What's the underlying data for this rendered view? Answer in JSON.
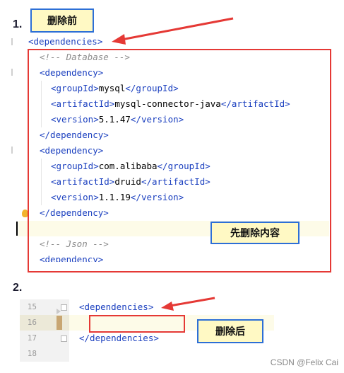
{
  "step1": {
    "number": "1.",
    "label": "删除前"
  },
  "step2": {
    "number": "2.",
    "label": "删除后"
  },
  "middle_label": "先删除内容",
  "code1": {
    "open_tag": "<dependencies>",
    "comment_db": "<!-- Database -->",
    "dep_open": "<dependency>",
    "dep_close": "</dependency>",
    "dep1": {
      "group_open": "<groupId>",
      "group_val": "mysql",
      "group_close": "</groupId>",
      "artifact_open": "<artifactId>",
      "artifact_val": "mysql-connector-java",
      "artifact_close": "</artifactId>",
      "version_open": "<version>",
      "version_val": "5.1.47",
      "version_close": "</version>"
    },
    "dep2": {
      "group_open": "<groupId>",
      "group_val": "com.alibaba",
      "group_close": "</groupId>",
      "artifact_open": "<artifactId>",
      "artifact_val": "druid",
      "artifact_close": "</artifactId>",
      "version_open": "<version>",
      "version_val": "1.1.19",
      "version_close": "</version>"
    },
    "comment_json": "<!-- Json -->",
    "dep3_partial": "<dependency>"
  },
  "code2": {
    "line_numbers": [
      "15",
      "16",
      "17",
      "18"
    ],
    "open_tag": "<dependencies>",
    "close_tag": "</dependencies>"
  },
  "watermark": "CSDN @Felix Cai",
  "colors": {
    "tag": "#1a3fbf",
    "comment": "#8c8c8c",
    "red": "#e53935",
    "callout_bg": "#fff9c4",
    "callout_border": "#2d6fd6"
  }
}
